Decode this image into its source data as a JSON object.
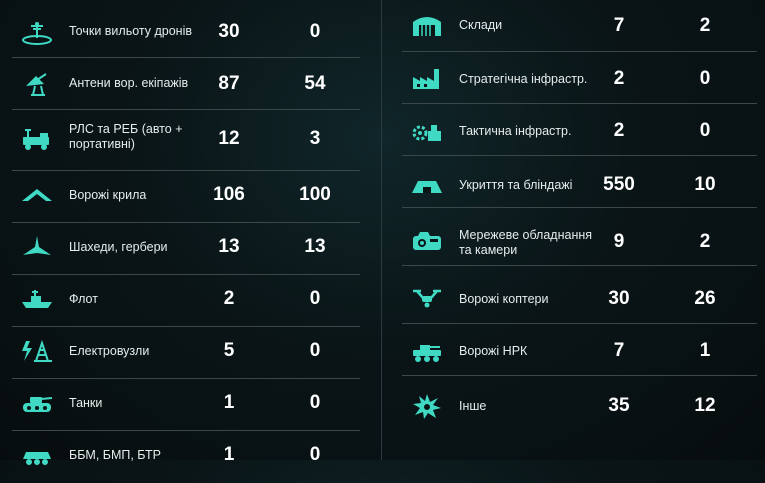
{
  "left_rows": [
    {
      "icon": "drone-launch-point-icon",
      "label": "Точки вильоту дронів",
      "v1": "30",
      "v2": "0"
    },
    {
      "icon": "antenna-icon",
      "label": "Антени вор. екіпажів",
      "v1": "87",
      "v2": "54"
    },
    {
      "icon": "radar-ew-vehicle-icon",
      "label_lines": [
        "РЛС та РЕБ (авто +",
        "портативні)"
      ],
      "v1": "12",
      "v2": "3"
    },
    {
      "icon": "fixed-wing-drone-icon",
      "label": "Ворожі крила",
      "v1": "106",
      "v2": "100"
    },
    {
      "icon": "shahed-drone-icon",
      "label": "Шахеди, гербери",
      "v1": "13",
      "v2": "13"
    },
    {
      "icon": "warship-icon",
      "label": "Флот",
      "v1": "2",
      "v2": "0"
    },
    {
      "icon": "power-substation-icon",
      "label": "Електровузли",
      "v1": "5",
      "v2": "0"
    },
    {
      "icon": "tank-icon",
      "label": "Танки",
      "v1": "1",
      "v2": "0"
    },
    {
      "icon": "armored-vehicle-icon",
      "label": "ББМ, БМП, БТР",
      "v1": "1",
      "v2": "0"
    }
  ],
  "right_rows": [
    {
      "icon": "warehouse-icon",
      "label": "Склади",
      "v1": "7",
      "v2": "2"
    },
    {
      "icon": "factory-icon",
      "label": "Стратегічна інфрастр.",
      "v1": "2",
      "v2": "0"
    },
    {
      "icon": "tactical-infrastructure-icon",
      "label": "Тактична інфрастр.",
      "v1": "2",
      "v2": "0"
    },
    {
      "icon": "bunker-icon",
      "label": "Укриття та бліндажі",
      "v1": "550",
      "v2": "10"
    },
    {
      "icon": "network-camera-icon",
      "label_lines": [
        "Мережеве обладнання",
        "та камери"
      ],
      "v1": "9",
      "v2": "2"
    },
    {
      "icon": "quadcopter-icon",
      "label": "Ворожі коптери",
      "v1": "30",
      "v2": "26"
    },
    {
      "icon": "ground-robot-icon",
      "label": "Ворожі НРК",
      "v1": "7",
      "v2": "1"
    },
    {
      "icon": "explosion-icon",
      "label": "Інше",
      "v1": "35",
      "v2": "12"
    }
  ],
  "colors": {
    "accent": "#3fd9c4",
    "background": "#0a1517",
    "divider": "#3b4749"
  }
}
